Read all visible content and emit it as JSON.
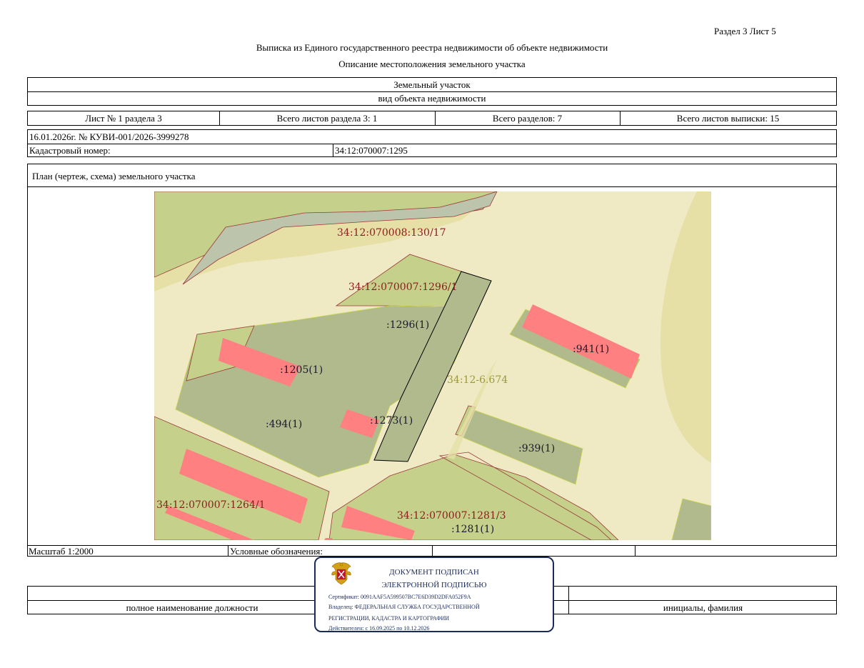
{
  "header": {
    "section_sheet": "Раздел 3    Лист 5",
    "title": "Выписка из Единого государственного реестра недвижимости об объекте недвижимости",
    "subtitle": "Описание местоположения земельного участка"
  },
  "object": {
    "type": "Земельный участок",
    "type_caption": "вид объекта недвижимости"
  },
  "sheets": {
    "sheet_no": "Лист № 1 раздела 3",
    "total_sheets_section": "Всего листов раздела 3: 1",
    "total_sections": "Всего разделов: 7",
    "total_sheets_extract": "Всего листов выписки: 15"
  },
  "record": {
    "date_number": "16.01.2026г. № КУВИ-001/2026-3999278",
    "cadastral_label": "Кадастровый номер:",
    "cadastral_value": "34:12:070007:1295"
  },
  "plan": {
    "title": "План (чертеж, схема) земельного участка"
  },
  "map_labels": {
    "parcel_130": "34:12:070008:130/17",
    "parcel_1296_1": "34:12:070007:1296/1",
    "l1296": ":1296(1)",
    "l941": ":941(1)",
    "l1205": ":1205(1)",
    "zone": "34:12-6.674",
    "l494": ":494(1)",
    "l1273": ":1273(1)",
    "l939": ":939(1)",
    "parcel_1264": "34:12:070007:1264/1",
    "parcel_1281_3": "34:12:070007:1281/3",
    "l1281": ":1281(1)"
  },
  "footer": {
    "scale": "Масштаб 1:2000",
    "legend": "Условные обозначения:",
    "position_caption": "полное наименование должности",
    "initials_caption": "инициалы, фамилия"
  },
  "stamp": {
    "line1": "ДОКУМЕНТ ПОДПИСАН",
    "line2": "ЭЛЕКТРОННОЙ ПОДПИСЬЮ",
    "certificate": "Сертификат: 0091AAF5A599507BC7E6D39D2DFA052F9A",
    "owner1": "Владелец: ФЕДЕРАЛЬНАЯ СЛУЖБА ГОСУДАРСТВЕННОЙ",
    "owner2": "РЕГИСТРАЦИИ, КАДАСТРА И КАРТОГРАФИИ",
    "valid": "Действителен: с 16.09.2025 по 10.12.2026"
  },
  "colors": {
    "building": "#ff8080",
    "parcel_green": "#c5d08a",
    "parcel_dark": "#b0ba8c",
    "land_light": "#efe9c4",
    "land_tan": "#e6e0a6",
    "water_grey": "#bcc4ac",
    "stamp_blue": "#1b2a5c"
  }
}
